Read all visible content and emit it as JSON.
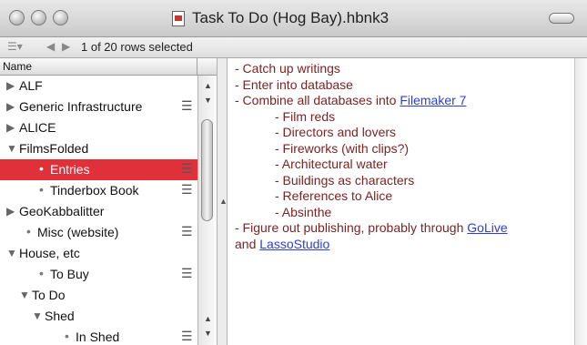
{
  "window": {
    "title": "Task To Do (Hog Bay).hbnk3"
  },
  "toolbar": {
    "row_status": "1 of 20 rows selected"
  },
  "outline": {
    "column_header": "Name",
    "rows": [
      {
        "label": "ALF",
        "kind": "collapsed",
        "menu": false,
        "selected": false
      },
      {
        "label": "Generic Infrastructure",
        "kind": "collapsed",
        "menu": true,
        "selected": false
      },
      {
        "label": "ALICE",
        "kind": "collapsed",
        "menu": false,
        "selected": false
      },
      {
        "label": "FilmsFolded",
        "kind": "expanded",
        "menu": false,
        "selected": false
      },
      {
        "label": "Entries",
        "kind": "leaf",
        "menu": true,
        "selected": true
      },
      {
        "label": "Tinderbox Book",
        "kind": "leaf",
        "menu": true,
        "selected": false
      },
      {
        "label": "GeoKabbalitter",
        "kind": "collapsed",
        "menu": false,
        "selected": false
      },
      {
        "label": "Misc (website)",
        "kind": "leaf",
        "menu": true,
        "selected": false
      },
      {
        "label": "House, etc",
        "kind": "expanded",
        "menu": false,
        "selected": false
      },
      {
        "label": "To Buy",
        "kind": "leaf",
        "menu": true,
        "selected": false
      },
      {
        "label": "To Do",
        "kind": "expanded",
        "menu": false,
        "selected": false
      },
      {
        "label": "Shed",
        "kind": "expanded",
        "menu": false,
        "selected": false
      },
      {
        "label": "In Shed",
        "kind": "leaf",
        "menu": true,
        "selected": false
      }
    ]
  },
  "note": {
    "lines": [
      {
        "text": "- Catch up writings"
      },
      {
        "text": "- Enter into database"
      },
      {
        "text": "- Combine all databases into ",
        "link": "Filemaker 7"
      },
      {
        "text": "- Film reds"
      },
      {
        "text": "- Directors and lovers"
      },
      {
        "text": "- Fireworks (with clips?)"
      },
      {
        "text": "- Architectural water"
      },
      {
        "text": "- Buildings as characters"
      },
      {
        "text": "- References to Alice"
      },
      {
        "text": "- Absinthe"
      },
      {
        "text": "- Figure out publishing, probably through ",
        "link": "GoLive"
      },
      {
        "text": "and ",
        "link": "LassoStudio"
      }
    ]
  },
  "colors": {
    "selection": "#e0303a",
    "note_text": "#7c2323",
    "link": "#2b3fd6"
  }
}
